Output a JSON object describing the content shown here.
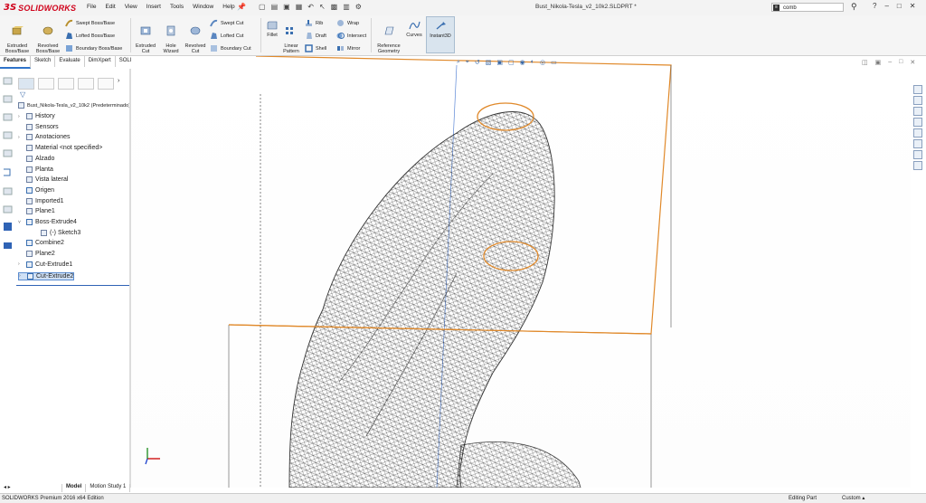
{
  "app": {
    "logo_ds": "3S",
    "logo_text": "SOLIDWORKS",
    "menus": [
      "File",
      "Edit",
      "View",
      "Insert",
      "Tools",
      "Window",
      "Help"
    ],
    "document_title": "Bust_Nikola-Tesla_v2_10k2.SLDPRT *",
    "search_value": "comb",
    "window_controls": [
      "?",
      "–",
      "□",
      "✕"
    ]
  },
  "ribbon": {
    "extruded_boss": "Extruded\nBoss/Base",
    "revolved_boss": "Revolved\nBoss/Base",
    "swept_boss": "Swept Boss/Base",
    "lofted_boss": "Lofted Boss/Base",
    "boundary_boss": "Boundary Boss/Base",
    "extruded_cut": "Extruded\nCut",
    "hole_wizard": "Hole\nWizard",
    "revolved_cut": "Revolved\nCut",
    "swept_cut": "Swept Cut",
    "lofted_cut": "Lofted Cut",
    "boundary_cut": "Boundary Cut",
    "fillet": "Fillet",
    "linear_pattern": "Linear\nPattern",
    "rib": "Rib",
    "draft": "Draft",
    "shell": "Shell",
    "wrap": "Wrap",
    "intersect": "Intersect",
    "mirror": "Mirror",
    "reference_geometry": "Reference\nGeometry",
    "curves": "Curves",
    "instant3d": "Instant3D"
  },
  "tabs": [
    "Features",
    "Sketch",
    "Evaluate",
    "DimXpert",
    "SOLIDWORKS Add-Ins"
  ],
  "tree": {
    "root": "Bust_Nikola-Tesla_v2_10k2 (Predeterminado)",
    "items": [
      {
        "label": "History",
        "arrow": "›"
      },
      {
        "label": "Sensors",
        "arrow": ""
      },
      {
        "label": "Anotaciones",
        "arrow": "›"
      },
      {
        "label": "Material <not specified>",
        "arrow": ""
      },
      {
        "label": "Alzado",
        "arrow": ""
      },
      {
        "label": "Planta",
        "arrow": ""
      },
      {
        "label": "Vista lateral",
        "arrow": ""
      },
      {
        "label": "Origen",
        "arrow": ""
      },
      {
        "label": "Imported1",
        "arrow": ""
      },
      {
        "label": "Plane1",
        "arrow": ""
      },
      {
        "label": "Boss-Extrude4",
        "arrow": "˅"
      },
      {
        "label": "(-) Sketch3",
        "arrow": ""
      },
      {
        "label": "Combine2",
        "arrow": ""
      },
      {
        "label": "Plane2",
        "arrow": ""
      },
      {
        "label": "Cut-Extrude1",
        "arrow": "›"
      },
      {
        "label": "Cut-Extrude2",
        "arrow": "›"
      }
    ]
  },
  "bottom_tabs": [
    "Model",
    "Motion Study 1"
  ],
  "status": {
    "left": "SOLIDWORKS Premium 2016 x64 Edition",
    "mode": "Editing Part",
    "units": "Custom"
  },
  "colors": {
    "accent": "#2f73c9",
    "highlight": "#e58a1f",
    "brand": "#d0021b"
  }
}
